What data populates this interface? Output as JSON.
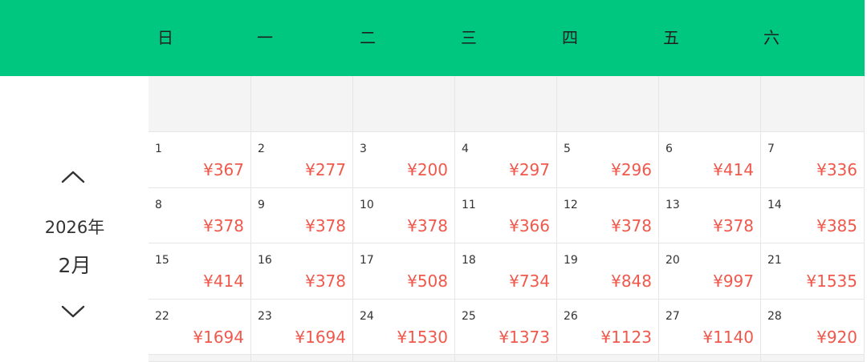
{
  "weekdays": [
    "日",
    "一",
    "二",
    "三",
    "四",
    "五",
    "六"
  ],
  "calendar": {
    "year": "2026年",
    "month": "2月",
    "weeks": [
      [
        null,
        null,
        null,
        null,
        null,
        null,
        null
      ],
      [
        {
          "day": "1",
          "price": "¥367"
        },
        {
          "day": "2",
          "price": "¥277"
        },
        {
          "day": "3",
          "price": "¥200"
        },
        {
          "day": "4",
          "price": "¥297"
        },
        {
          "day": "5",
          "price": "¥296"
        },
        {
          "day": "6",
          "price": "¥414"
        },
        {
          "day": "7",
          "price": "¥336"
        }
      ],
      [
        {
          "day": "8",
          "price": "¥378"
        },
        {
          "day": "9",
          "price": "¥378"
        },
        {
          "day": "10",
          "price": "¥378"
        },
        {
          "day": "11",
          "price": "¥366"
        },
        {
          "day": "12",
          "price": "¥378"
        },
        {
          "day": "13",
          "price": "¥378"
        },
        {
          "day": "14",
          "price": "¥385"
        }
      ],
      [
        {
          "day": "15",
          "price": "¥414"
        },
        {
          "day": "16",
          "price": "¥378"
        },
        {
          "day": "17",
          "price": "¥508"
        },
        {
          "day": "18",
          "price": "¥734"
        },
        {
          "day": "19",
          "price": "¥848"
        },
        {
          "day": "20",
          "price": "¥997"
        },
        {
          "day": "21",
          "price": "¥1535"
        }
      ],
      [
        {
          "day": "22",
          "price": "¥1694"
        },
        {
          "day": "23",
          "price": "¥1694"
        },
        {
          "day": "24",
          "price": "¥1530"
        },
        {
          "day": "25",
          "price": "¥1373"
        },
        {
          "day": "26",
          "price": "¥1123"
        },
        {
          "day": "27",
          "price": "¥1140"
        },
        {
          "day": "28",
          "price": "¥920"
        }
      ]
    ]
  },
  "icons": {
    "prev": "chevron-up-icon",
    "next": "chevron-down-icon"
  },
  "colors": {
    "header": "#00c77f",
    "price": "#f0584c"
  }
}
